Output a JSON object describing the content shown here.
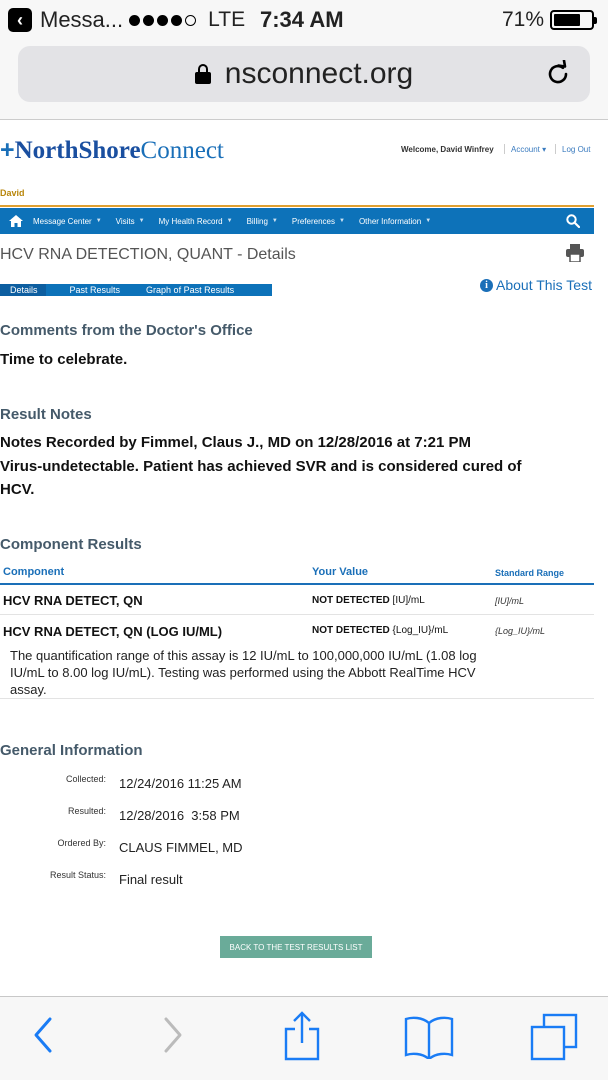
{
  "status_bar": {
    "back_app": "Messa...",
    "carrier": "LTE",
    "time": "7:34 AM",
    "battery": "71%",
    "battery_level": 0.71
  },
  "browser": {
    "url": "nsconnect.org"
  },
  "header": {
    "logo_cross": "+",
    "logo_north": "NorthShore",
    "logo_connect": "Connect",
    "welcome": "Welcome, David Winfrey",
    "account": "Account",
    "logout": "Log Out",
    "user_tab": "David"
  },
  "nav": {
    "items": [
      "Message Center",
      "Visits",
      "My Health Record",
      "Billing",
      "Preferences",
      "Other Information"
    ]
  },
  "page": {
    "title": "HCV RNA DETECTION, QUANT - Details",
    "tabs": [
      "Details",
      "Past Results",
      "Graph of Past Results"
    ],
    "about_link": "About This Test"
  },
  "comments": {
    "heading": "Comments from the Doctor's Office",
    "text": "Time to celebrate."
  },
  "result_notes": {
    "heading": "Result Notes",
    "line1": "Notes Recorded by Fimmel, Claus J., MD on 12/28/2016 at 7:21 PM",
    "line2": "Virus-undetectable.  Patient has achieved SVR and is considered cured of",
    "line3": "HCV."
  },
  "components": {
    "heading": "Component Results",
    "columns": [
      "Component",
      "Your Value",
      "Standard Range"
    ],
    "rows": [
      {
        "name": "HCV RNA DETECT, QN",
        "value": "NOT DETECTED",
        "unit": " [IU]/mL",
        "range": "[IU]/mL"
      },
      {
        "name": "HCV RNA DETECT, QN (LOG IU/ML)",
        "value": "NOT DETECTED",
        "unit": " {Log_IU}/mL",
        "range": "{Log_IU}/mL",
        "note": "The quantification range of this assay is 12 IU/mL to 100,000,000 IU/mL (1.08 log IU/mL to 8.00 log IU/mL). Testing was performed using the Abbott RealTime HCV assay."
      }
    ]
  },
  "general": {
    "heading": "General Information",
    "fields": [
      {
        "label": "Collected:",
        "value": "12/24/2016 11:25 AM"
      },
      {
        "label": "Resulted:",
        "value": "12/28/2016  3:58 PM"
      },
      {
        "label": "Ordered By:",
        "value": "CLAUS FIMMEL, MD"
      },
      {
        "label": "Result Status:",
        "value": "Final result"
      }
    ]
  },
  "back_button": "BACK TO THE TEST RESULTS LIST",
  "colors": {
    "brand_blue": "#0d72b9",
    "accent_orange": "#e0a030",
    "button_green": "#6aab99"
  }
}
